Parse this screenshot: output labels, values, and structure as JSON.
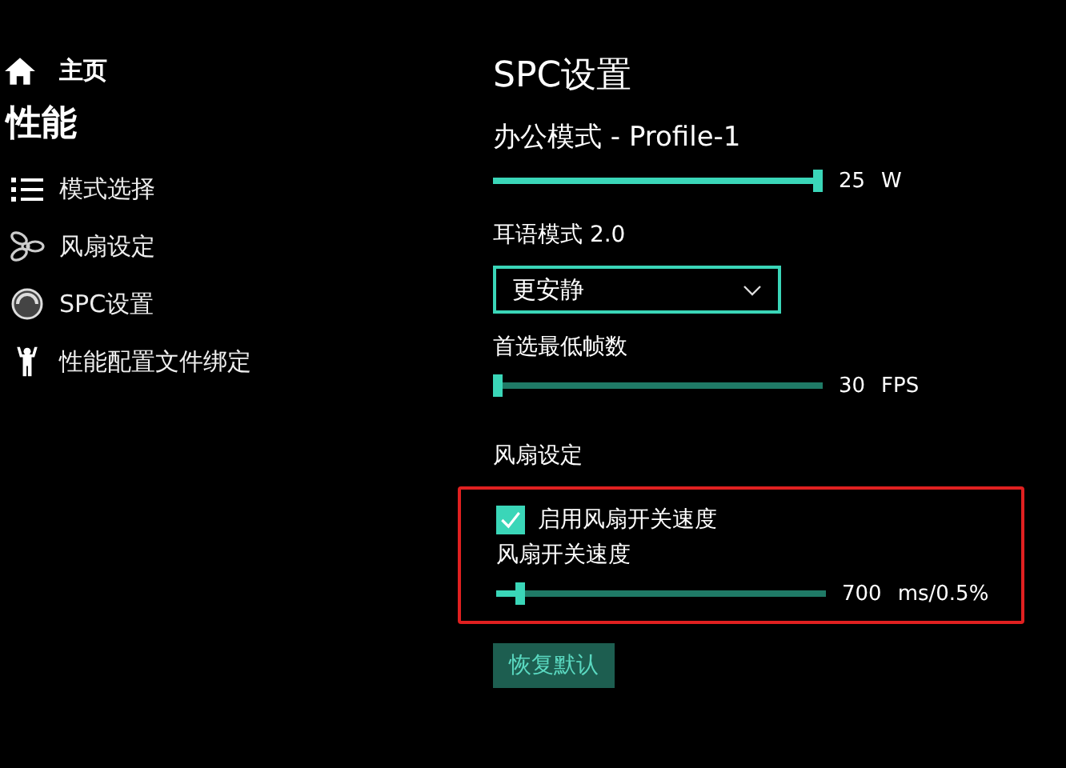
{
  "sidebar": {
    "home": {
      "label": "主页"
    },
    "section": "性能",
    "items": [
      {
        "label": "模式选择"
      },
      {
        "label": "风扇设定"
      },
      {
        "label": "SPC设置"
      },
      {
        "label": "性能配置文件绑定"
      }
    ]
  },
  "page": {
    "title": "SPC设置",
    "profile": "办公模式 - Profile-1",
    "power_slider": {
      "level": 1.0,
      "value": "25",
      "unit": "W"
    },
    "whisper": {
      "label": "耳语模式 2.0",
      "dropdown": {
        "value": "更安静"
      }
    },
    "fps": {
      "label": "首选最低帧数",
      "level": 0.0,
      "value": "30",
      "unit": "FPS"
    },
    "fan_section": {
      "heading": "风扇设定",
      "highlighted": true,
      "checkbox": {
        "label": "启用风扇开关速度",
        "checked": true
      },
      "slider": {
        "label": "风扇开关速度",
        "level": 0.06,
        "value": "700",
        "unit": "ms/0.5%"
      }
    },
    "reset_button": "恢复默认"
  }
}
